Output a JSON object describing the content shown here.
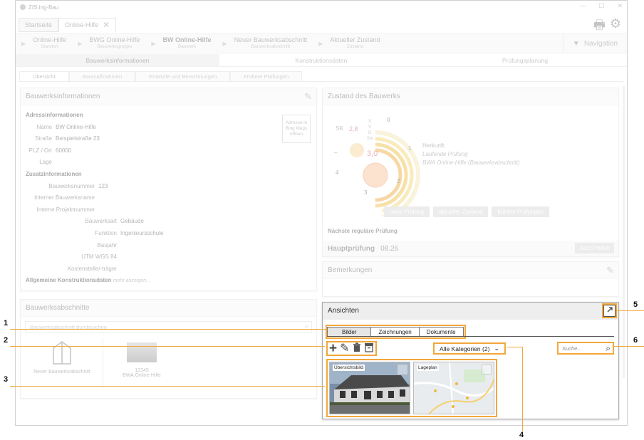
{
  "window": {
    "title": "ZIS.ing-Bau",
    "controls": [
      "—",
      "☐",
      "✕"
    ],
    "app_tabs": [
      {
        "label": "Startseite"
      },
      {
        "label": "Online-Hilfe",
        "close": "✕"
      }
    ]
  },
  "breadcrumbs": [
    {
      "main": "Online-Hilfe",
      "sub": "Standort"
    },
    {
      "main": "BWG Online-Hilfe",
      "sub": "Bauwerksgruppe"
    },
    {
      "main": "BW Online-Hilfe",
      "sub": "Bauwerk"
    },
    {
      "main": "Neuer Bauwerksabschnitt",
      "sub": "Bauwerksabschnitt"
    },
    {
      "main": "Aktueller Zustand",
      "sub": "Zustand"
    }
  ],
  "navigation_label": "Navigation",
  "main_tabs": [
    "Bauwerksinformationen",
    "Konstruktionsdaten",
    "Prüfungsplanung"
  ],
  "sub_tabs": [
    "Übersicht",
    "Baumaßnahmen",
    "Entwürfe und Berechnungen",
    "Frühere Prüfungen"
  ],
  "bauwerksinfo": {
    "title": "Bauwerksinformationen",
    "bing_button": "Adresse in Bing Maps öffnen",
    "adress_header": "Adressinformationen",
    "name_label": "Name",
    "name_value": "BW Online-Hilfe",
    "strasse_label": "Straße",
    "strasse_value": "Beispielstraße 23",
    "plz_label": "PLZ / Ort",
    "plz_value": "60000",
    "lage_label": "Lage",
    "zusatz_header": "Zusatzinformationen",
    "bwnr_label": "Bauwerksnummer",
    "bwnr_value": "123",
    "intname_label": "Interner Bauwerksname",
    "intproj_label": "Interne Projektnummer",
    "art_label": "Bauwerksart",
    "art_value": "Gebäude",
    "funktion_label": "Funktion",
    "funktion_value": "Ingenieursschule",
    "baujahr_label": "Baujahr",
    "utm_label": "UTM WGS 84",
    "kosten_label": "Kostenstelle/-träger",
    "allg_header": "Allgemeine Konstruktionsdaten",
    "mehr": "mehr anzeigen..."
  },
  "abschnitte": {
    "title": "Bauwerksabschnitte",
    "search_placeholder": "Bauwerksabschnitt durchsuchen",
    "new_label": "Neuer Bauwerksabschnitt",
    "tile_id": "12345",
    "tile_name": "BWA Online-Hilfe"
  },
  "zustand": {
    "title": "Zustand des Bauwerks",
    "sk_label": "SK",
    "sk_value": "2,8",
    "center_value": "3,0",
    "svd_labels": [
      "S",
      "V",
      "D",
      "Sm"
    ],
    "scale": [
      "0",
      "1",
      "2",
      "3",
      "4"
    ],
    "dash": "–",
    "herkunft_label": "Herkunft:",
    "herkunft_1": "Laufende Prüfung",
    "herkunft_2": "BWA Online-Hilfe (Bauwerksabschnitt)",
    "buttons": [
      "neue Prüfung",
      "aktueller Zustand",
      "frühere Prüfungen"
    ],
    "naechste": "Nächste reguläre Prüfung",
    "hp_label": "Hauptprüfung",
    "hp_value": "08.26",
    "jetzt": "Jetzt Prüfen"
  },
  "bemerkungen": {
    "title": "Bemerkungen"
  },
  "ansichten": {
    "title": "Ansichten",
    "tabs": [
      "Bilder",
      "Zeichnungen",
      "Dokumente"
    ],
    "category": "Alle Kategorien (2)",
    "search_placeholder": "Suche...",
    "thumbs": [
      {
        "label": "Übersichtsbild"
      },
      {
        "label": "Lageplan"
      }
    ]
  },
  "callouts": [
    "1",
    "2",
    "3",
    "4",
    "5",
    "6"
  ],
  "colors": {
    "accent": "#f2a73b"
  }
}
